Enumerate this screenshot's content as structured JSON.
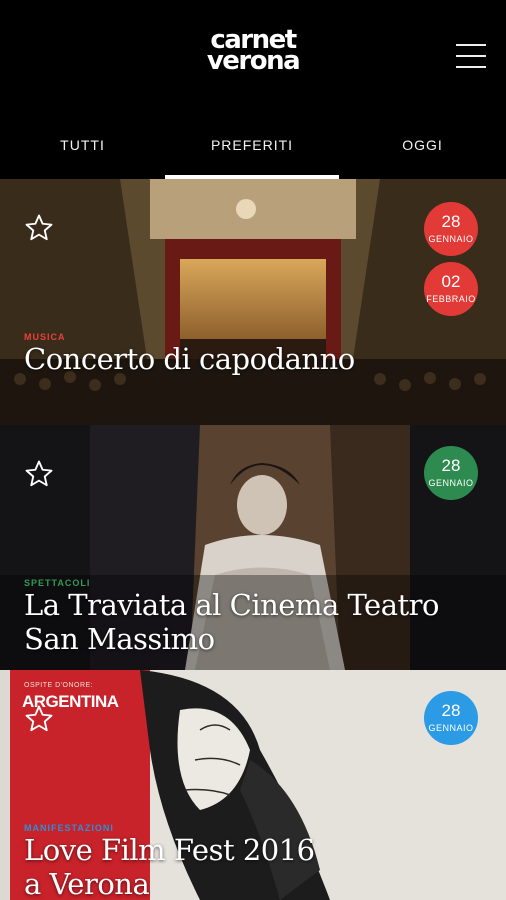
{
  "header": {
    "logo_line1": "carnet",
    "logo_line2": "verona",
    "menu_icon": "hamburger-menu-icon"
  },
  "tabs": [
    {
      "label": "TUTTI"
    },
    {
      "label": "PREFERITI",
      "active": true
    },
    {
      "label": "OGGI"
    }
  ],
  "events": [
    {
      "category": "MUSICA",
      "category_color": "#e8423a",
      "title": "Concerto di capodanno",
      "dates": [
        {
          "day": "28",
          "month": "GENNAIO",
          "color": "#e23a36"
        },
        {
          "day": "02",
          "month": "FEBBRAIO",
          "color": "#e23a36"
        }
      ]
    },
    {
      "category": "SPETTACOLI",
      "category_color": "#2f9a5a",
      "title_line1": "La Traviata al Cinema Teatro",
      "title_line2": "San Massimo",
      "dates": [
        {
          "day": "28",
          "month": "GENNAIO",
          "color": "#2e8b4f"
        }
      ]
    },
    {
      "category": "MANIFESTAZIONI",
      "category_color": "#2d8fd6",
      "title_line1": "Love Film Fest 2016",
      "title_line2": "a Verona",
      "poster_text_small": "OSPITE D'ONORE:",
      "poster_text_big": "ARGENTINA",
      "dates": [
        {
          "day": "28",
          "month": "GENNAIO",
          "color": "#2b9be6"
        }
      ]
    }
  ],
  "colors": {
    "background": "#000000",
    "tab_indicator": "#ffffff"
  }
}
